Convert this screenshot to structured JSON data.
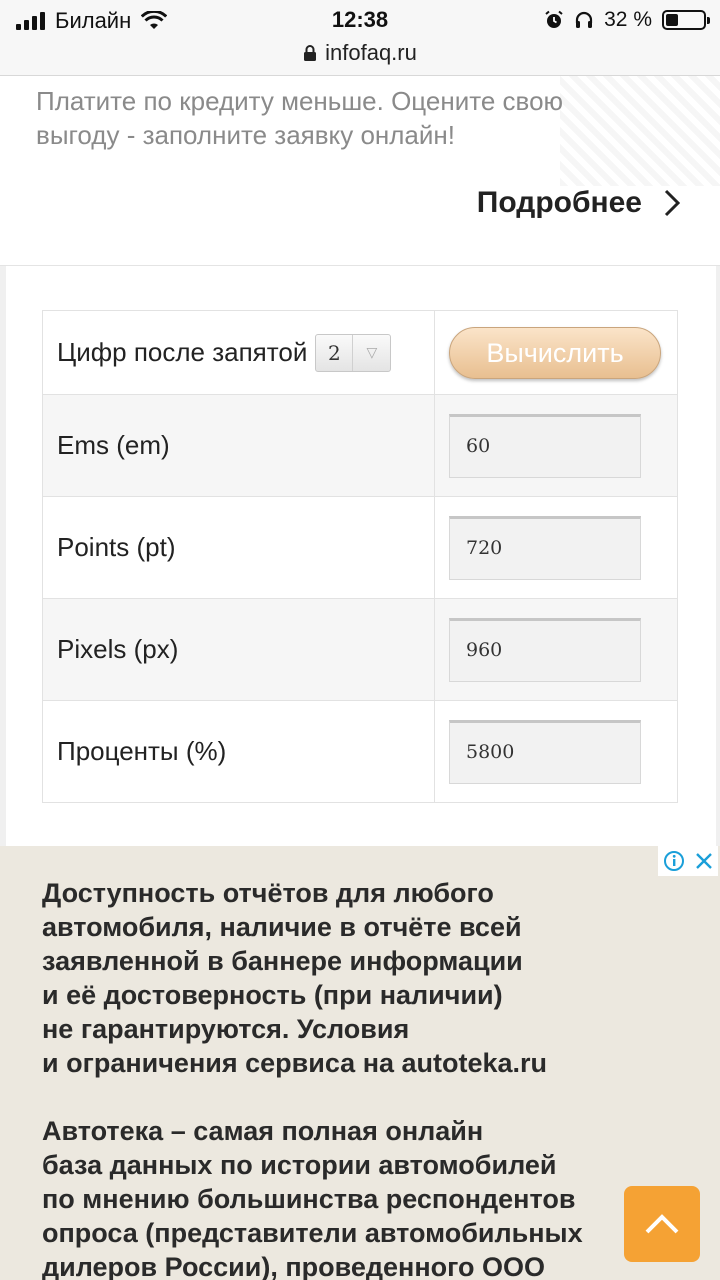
{
  "status_bar": {
    "carrier": "Билайн",
    "time": "12:38",
    "url": "infofaq.ru",
    "battery_text": "32 %",
    "battery_level": 0.32
  },
  "promo": {
    "text": "Платите по кредиту меньше. Оцените свою выгоду - заполните заявку онлайн!",
    "link_label": "Подробнее"
  },
  "calculator": {
    "digits_label": "Цифр после запятой",
    "digits_value": "2",
    "compute_button": "Вычислить",
    "rows": [
      {
        "label": "Ems (em)",
        "value": "60"
      },
      {
        "label": "Points (pt)",
        "value": "720"
      },
      {
        "label": "Pixels (px)",
        "value": "960"
      },
      {
        "label": "Проценты (%)",
        "value": "5800"
      }
    ]
  },
  "ad": {
    "paragraph_1_lines": [
      "Доступность отчётов для любого",
      "автомобиля, наличие в отчёте всей",
      "заявленной в баннере информации",
      "и её достоверность (при наличии)",
      "не гарантируются. Условия",
      "и ограничения сервиса на autoteka.ru"
    ],
    "paragraph_2_lines": [
      "Автотека – самая полная онлайн",
      "база данных по истории автомобилей",
      "по мнению большинства респондентов",
      "опроса (представители автомобильных",
      "дилеров России), проведенного ООО"
    ]
  },
  "colors": {
    "accent_orange": "#f5a234",
    "button_gradient_top": "#fbe4c9",
    "button_gradient_bottom": "#e8bf90",
    "ad_background": "#ece8df",
    "adchoices_blue": "#1a9fd9"
  },
  "icons": [
    "cellular-signal-icon",
    "wifi-icon",
    "lock-icon",
    "alarm-icon",
    "headphones-icon",
    "battery-icon",
    "chevron-right-icon",
    "info-icon",
    "close-icon",
    "chevron-up-icon"
  ]
}
